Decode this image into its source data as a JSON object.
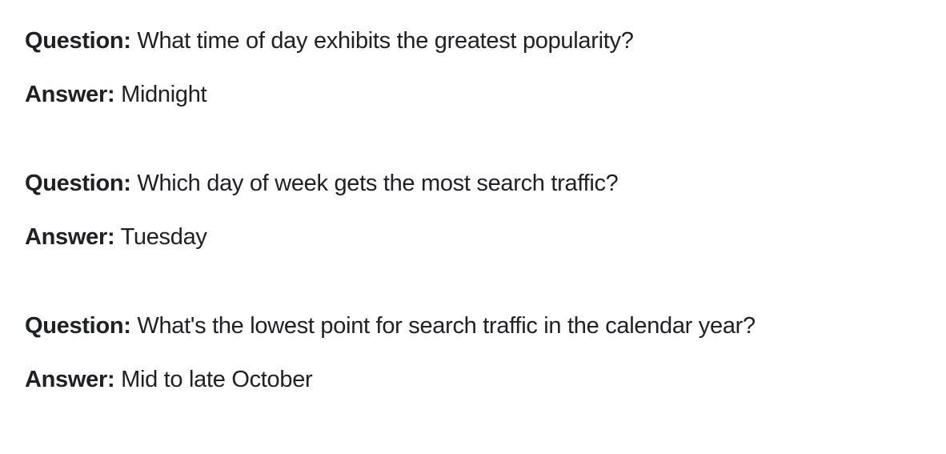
{
  "question_label": "Question:",
  "answer_label": "Answer:",
  "qa": [
    {
      "question": "What time of day exhibits the greatest popularity?",
      "answer": "Midnight"
    },
    {
      "question": "Which day of week gets the most search traffic?",
      "answer": "Tuesday"
    },
    {
      "question": "What's the lowest point for search traffic in the calendar year?",
      "answer": "Mid to late October"
    }
  ]
}
